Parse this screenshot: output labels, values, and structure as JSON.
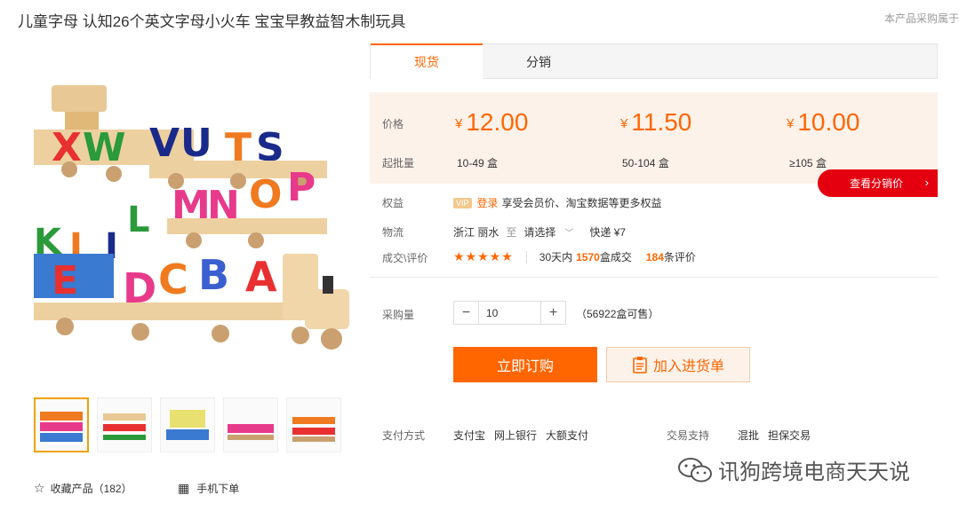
{
  "header": {
    "title": "儿童字母 认知26个英文字母小火车 宝宝早教益智木制玩具",
    "note": "本产品采购属于"
  },
  "tabs": [
    {
      "label": "现货",
      "active": true
    },
    {
      "label": "分销",
      "active": false
    }
  ],
  "price": {
    "price_label": "价格",
    "moq_label": "起批量",
    "currency": "¥",
    "tiers": [
      {
        "price": "12.00",
        "range": "10-49 盒"
      },
      {
        "price": "11.50",
        "range": "50-104 盒"
      },
      {
        "price": "10.00",
        "range": "≥105 盒"
      }
    ],
    "distribution_button": "查看分销价"
  },
  "benefits": {
    "label": "权益",
    "vip": "VIP",
    "login": "登录",
    "text": "享受会员价、淘宝数据等更多权益"
  },
  "logistics": {
    "label": "物流",
    "origin": "浙江 丽水",
    "to": "至",
    "dest_select": "请选择",
    "shipping": "快递 ¥7"
  },
  "reviews": {
    "label": "成交\\评价",
    "rating_stars": 5,
    "sales_prefix": "30天内",
    "sales_count": "1570",
    "sales_suffix": "盒成交",
    "review_count": "184",
    "review_suffix": "条评价"
  },
  "purchase": {
    "label": "采购量",
    "quantity": "10",
    "minus": "−",
    "plus": "+",
    "stock": "（56922盒可售）"
  },
  "actions": {
    "buy_now": "立即订购",
    "add_to_cart": "加入进货单"
  },
  "payment": {
    "label": "支付方式",
    "methods": [
      "支付宝",
      "网上银行",
      "大额支付"
    ],
    "trade_label": "交易支持",
    "trade_methods": [
      "混批",
      "担保交易"
    ]
  },
  "footer": {
    "favorite": "收藏产品（182）",
    "mobile": "手机下单"
  },
  "watermark": "讯狗跨境电商天天说",
  "colors": {
    "accent": "#ff6600",
    "red": "#e4000f",
    "price_bg": "#fdf2ea"
  }
}
